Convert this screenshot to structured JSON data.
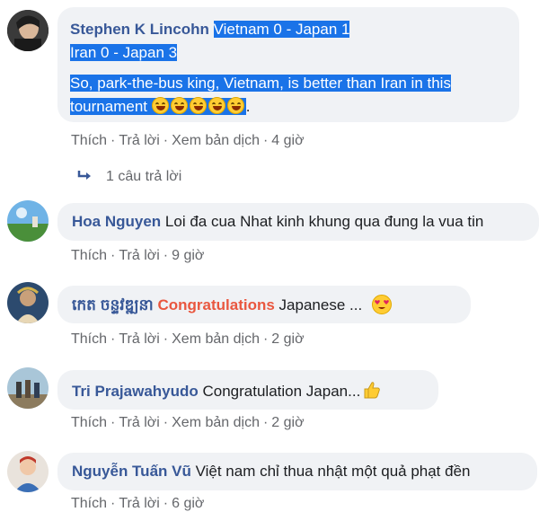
{
  "comments": [
    {
      "author": "Stephen K Lincohn",
      "line1": "Vietnam 0 - Japan 1",
      "line2": "Iran 0 - Japan 3",
      "line3": "So, park-the-bus king, Vietnam, is better than Iran in this",
      "line4_text": "tournament",
      "line4_tail": ".",
      "emoji_count": 5,
      "actions": {
        "like": "Thích",
        "reply": "Trả lời",
        "translate": "Xem bản dịch",
        "time": "4 giờ"
      },
      "replies_label": "1 câu trả lời"
    },
    {
      "author": "Hoa Nguyen",
      "text": "Loi đa cua Nhat kinh khung qua đung la vua tin",
      "actions": {
        "like": "Thích",
        "reply": "Trả lời",
        "time": "9 giờ"
      }
    },
    {
      "author": "កេត ចន្ទវឌ្ឍនា",
      "highlight": "Congratulations",
      "text": "Japanese ...",
      "actions": {
        "like": "Thích",
        "reply": "Trả lời",
        "translate": "Xem bản dịch",
        "time": "2 giờ"
      }
    },
    {
      "author": "Tri Prajawahyudo",
      "text": "Congratulation Japan...",
      "actions": {
        "like": "Thích",
        "reply": "Trả lời",
        "translate": "Xem bản dịch",
        "time": "2 giờ"
      }
    },
    {
      "author": "Nguyễn Tuấn Vũ",
      "text": "Việt nam chỉ thua nhật một quả phạt đền",
      "actions": {
        "like": "Thích",
        "reply": "Trả lời",
        "time": "6 giờ"
      }
    }
  ],
  "colors": {
    "author": "#385898",
    "bubble": "#f0f2f5",
    "selection": "#1a73e8",
    "meta": "#65676b",
    "highlight": "#e9573f"
  },
  "separator": "·"
}
